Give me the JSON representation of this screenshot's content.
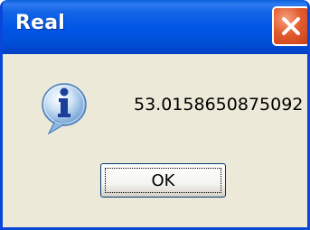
{
  "window": {
    "title": "Real",
    "close_icon": "close-icon",
    "accent_color": "#0055e5",
    "close_color": "#e35c2e"
  },
  "dialog": {
    "icon": "info-icon",
    "message": "53.0158650875092",
    "ok_label": "OK"
  }
}
